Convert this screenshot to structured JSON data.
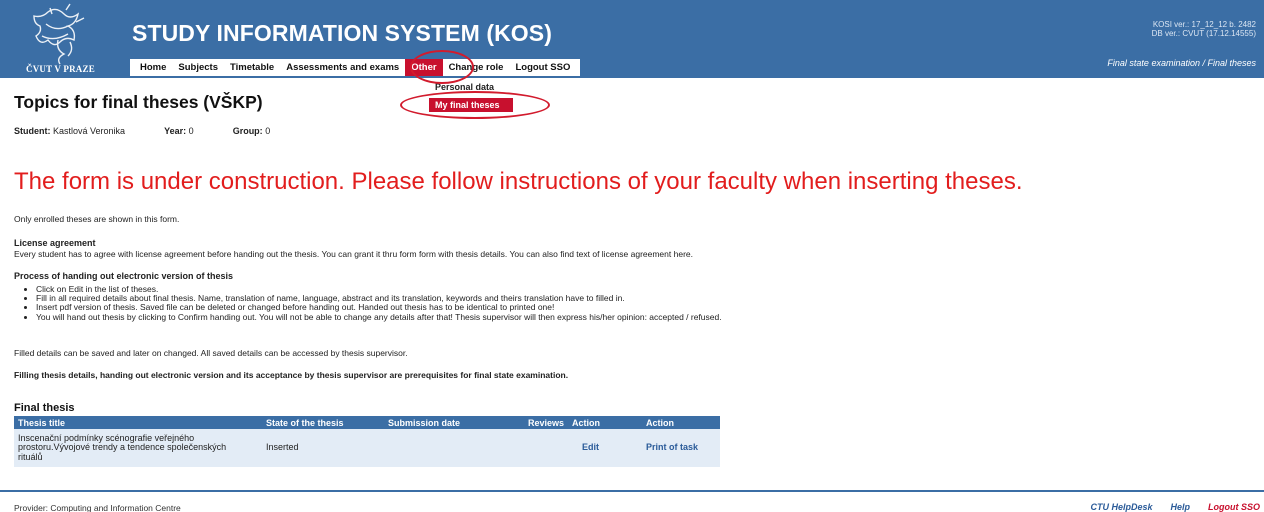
{
  "header": {
    "logo_text": "ČVUT V PRAZE",
    "title": "STUDY INFORMATION SYSTEM (KOS)",
    "version_line1": "KOSI ver.: 17_12_12 b. 2482",
    "version_line2": "DB ver.: CVUT (17.12.14555)",
    "location": "Final state examination / Final theses",
    "nav": [
      "Home",
      "Subjects",
      "Timetable",
      "Assessments and exams",
      "Other",
      "Change role",
      "Logout SSO"
    ],
    "dropdown": [
      "Personal data",
      "My final theses"
    ]
  },
  "page": {
    "title": "Topics for final theses (VŠKP)",
    "student_label": "Student:",
    "student_value": "Kastlová Veronika",
    "year_label": "Year:",
    "year_value": "0",
    "group_label": "Group:",
    "group_value": "0",
    "notice": "The form is under construction. Please follow instructions of your faculty when inserting theses.",
    "enrolled_note": "Only enrolled theses are shown in this form.",
    "license_heading": "License agreement",
    "license_text": "Every student has to agree with license agreement before handing out the thesis. You can grant it thru form form with thesis details. You can also find text of license agreement here.",
    "process_heading": "Process of handing out electronic version of thesis",
    "process_steps": [
      "Click on Edit in the list of theses.",
      "Fill in all required details about final thesis. Name, translation of name, language, abstract and its translation, keywords and theirs translation have to filled in.",
      "Insert pdf version of thesis. Saved file can be deleted or changed before handing out. Handed out thesis has to be identical to printed one!",
      "You will hand out thesis by clicking to Confirm handing out. You will not be able to change any details after that! Thesis supervisor will then express his/her opinion: accepted / refused."
    ],
    "saved_note": "Filled details can be saved and later on changed. All saved details can be accessed by thesis supervisor.",
    "prereq_note": "Filling thesis details, handing out electronic version and its acceptance by thesis supervisor are prerequisites for final state examination."
  },
  "final_thesis": {
    "heading": "Final thesis",
    "columns": [
      "Thesis title",
      "State of the thesis",
      "Submission date",
      "Reviews",
      "Action",
      "Action"
    ],
    "rows": [
      {
        "title_line1": "Inscenační podmínky scénografie veřejného",
        "title_line2": "prostoru.Vývojové trendy a tendence společenských",
        "title_line3": "rituálů",
        "state": "Inserted",
        "submission_date": "",
        "reviews": "",
        "edit": "Edit",
        "print": "Print of task"
      }
    ]
  },
  "footer": {
    "provider": "Provider: Computing and Information Centre",
    "links": [
      "CTU HelpDesk",
      "Help",
      "Logout SSO"
    ]
  },
  "colors": {
    "header_blue": "#3b6ea5",
    "accent_red": "#c8102e",
    "notice_red": "#e21d1d",
    "row_bg": "#e3ecf6"
  }
}
